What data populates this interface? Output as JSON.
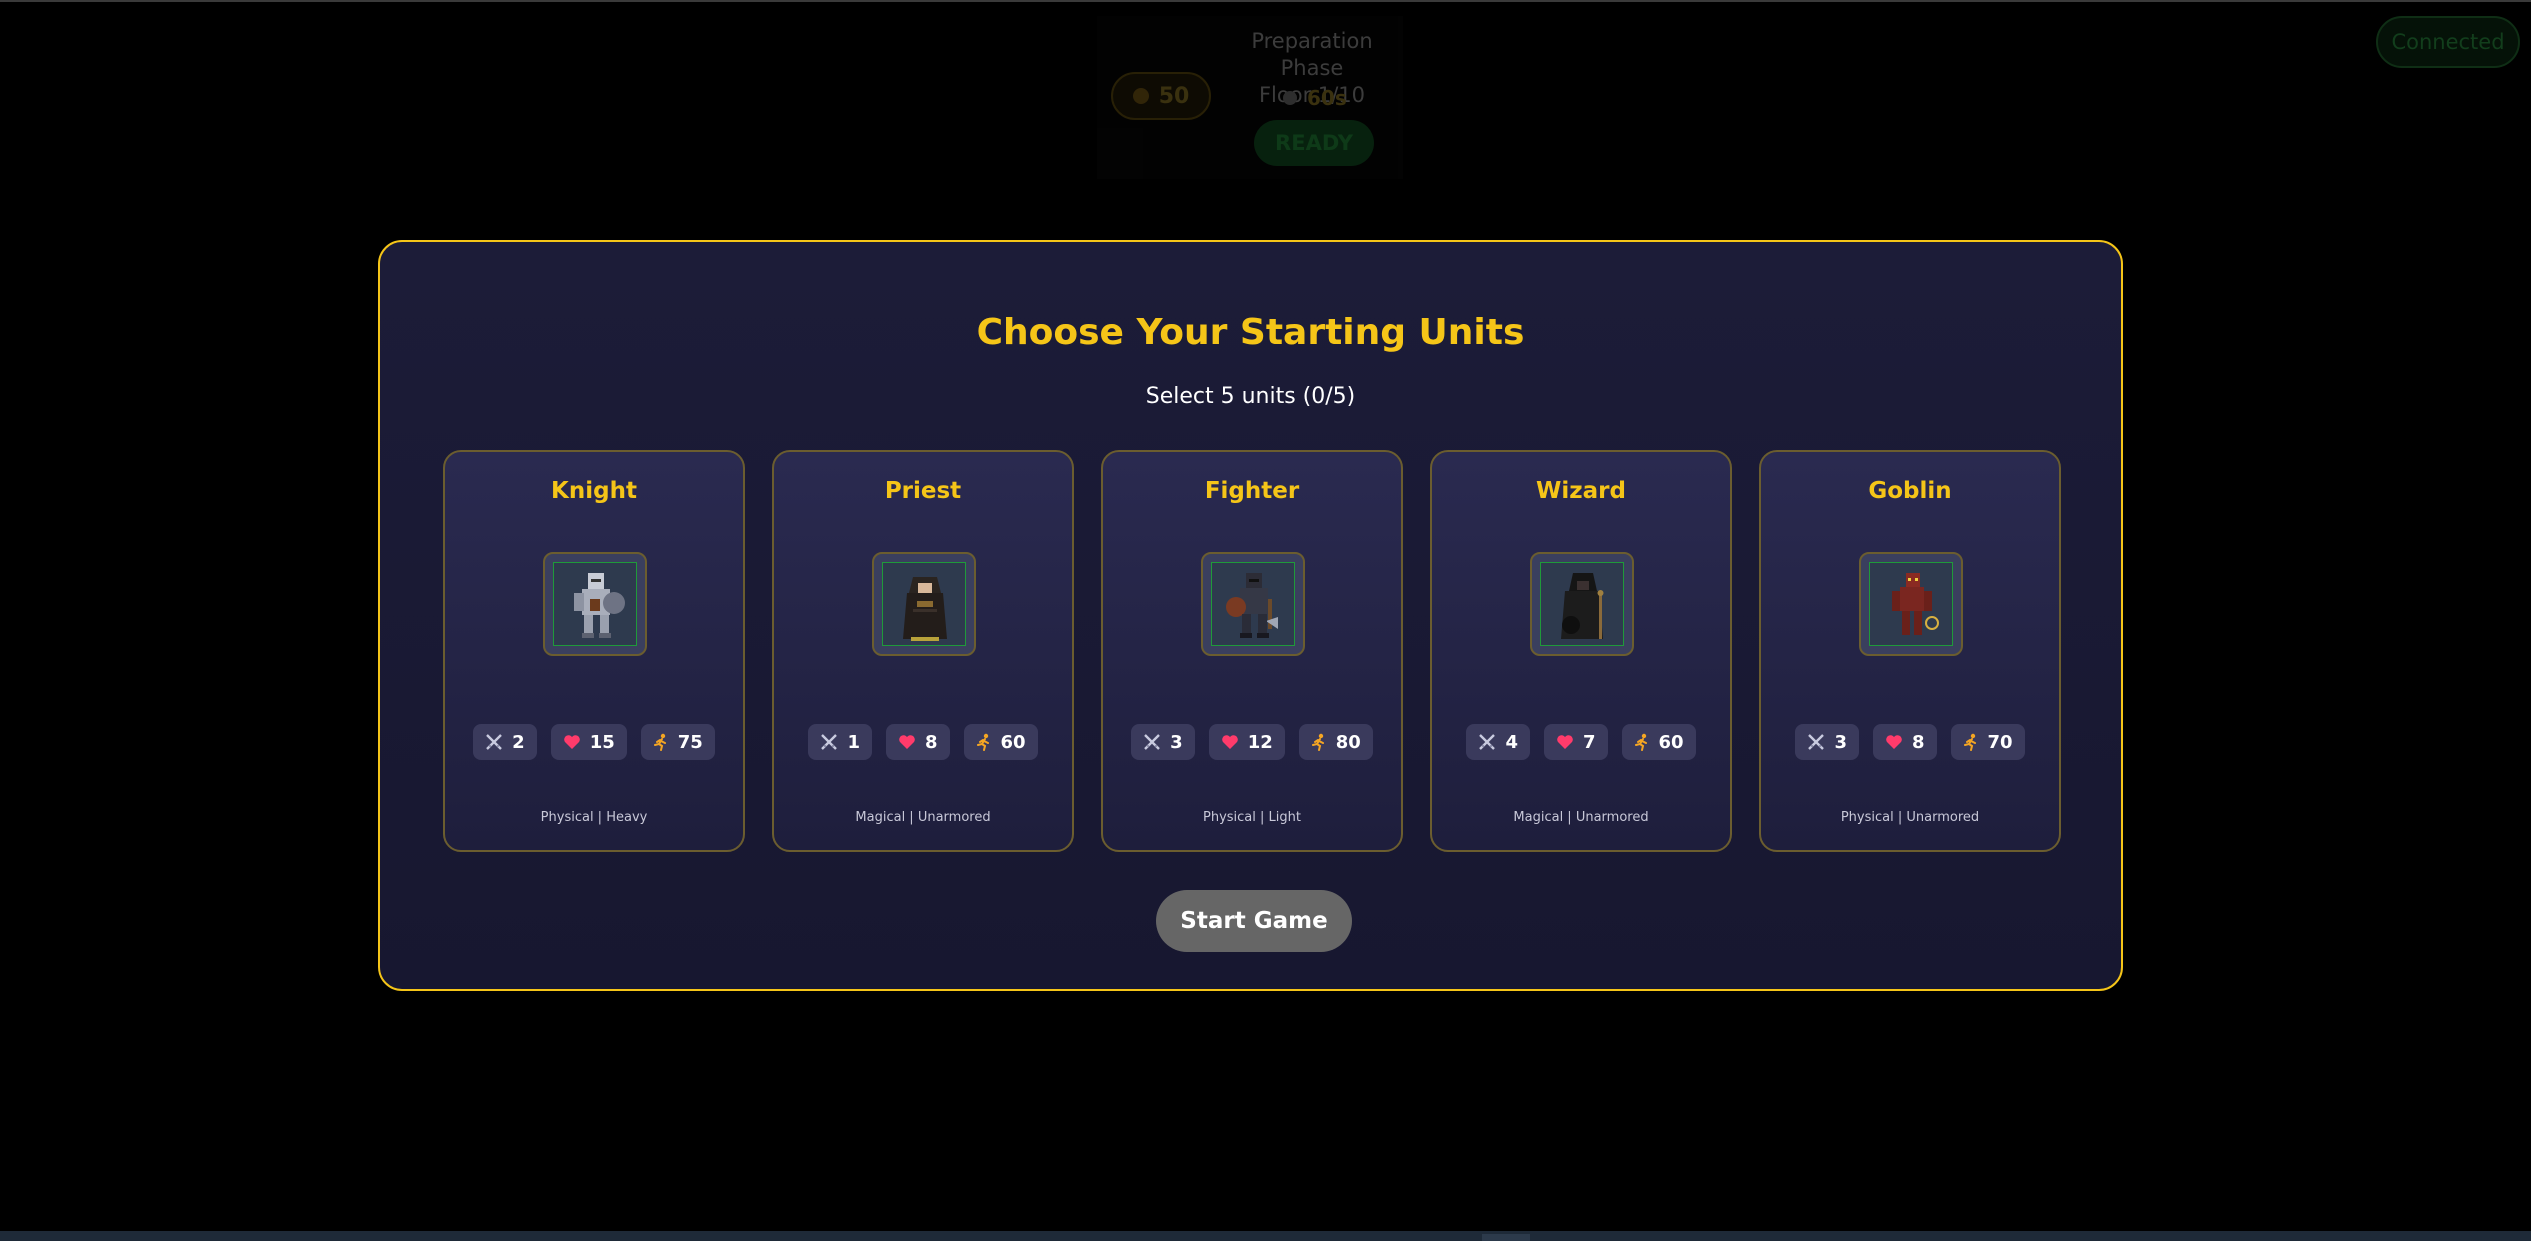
{
  "hud": {
    "gold": "50",
    "phase": "Preparation Phase",
    "floor": "Floor 1/10",
    "timer": "60s",
    "ready_label": "READY",
    "connection_status": "Connected"
  },
  "modal": {
    "title": "Choose Your Starting Units",
    "subtitle": "Select 5 units (0/5)",
    "start_label": "Start Game"
  },
  "units": [
    {
      "name": "Knight",
      "attack": "2",
      "health": "15",
      "speed": "75",
      "tags": "Physical | Heavy"
    },
    {
      "name": "Priest",
      "attack": "1",
      "health": "8",
      "speed": "60",
      "tags": "Magical | Unarmored"
    },
    {
      "name": "Fighter",
      "attack": "3",
      "health": "12",
      "speed": "80",
      "tags": "Physical | Light"
    },
    {
      "name": "Wizard",
      "attack": "4",
      "health": "7",
      "speed": "60",
      "tags": "Magical | Unarmored"
    },
    {
      "name": "Goblin",
      "attack": "3",
      "health": "8",
      "speed": "70",
      "tags": "Physical | Unarmored"
    }
  ],
  "icons": {
    "attack": "crossed-swords-icon",
    "health": "heart-icon",
    "speed": "running-figure-icon",
    "gold": "coin-icon",
    "timer": "clock-icon"
  },
  "colors": {
    "accent": "#f5c518",
    "modal_bg": "#1c1c38",
    "card_bg": "#2a2a50",
    "heart": "#ff3b6b",
    "speed": "#f5a623",
    "button": "#666666"
  }
}
